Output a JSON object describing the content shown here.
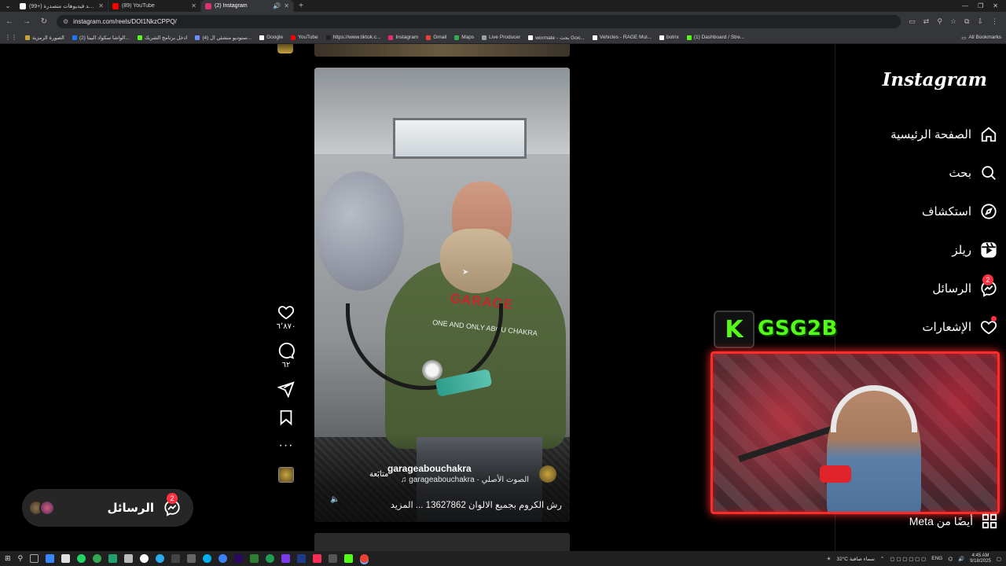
{
  "browser": {
    "tabs": [
      {
        "title": "(99+) شاهد فيديوهات متصدرة",
        "favicon_color": "#ffffff",
        "active": false
      },
      {
        "title": "(89) YouTube",
        "favicon_color": "#ff0000",
        "active": false
      },
      {
        "title": "(2) Instagram",
        "favicon_color": "#e1306c",
        "active": true
      }
    ],
    "url": "instagram.com/reels/DOI1NkzCPPQ/",
    "bookmarks": [
      {
        "label": "الصورة الرمزية",
        "color": "#c9a33b"
      },
      {
        "label": "(2) الواشا سكواد البيتا...",
        "color": "#1877f2"
      },
      {
        "label": "ادخل برنامج الشريك",
        "color": "#53fc18"
      },
      {
        "label": "(4) ستوديو منشئي ال...",
        "color": "#6c8cff"
      },
      {
        "label": "Google",
        "color": "#ffffff"
      },
      {
        "label": "YouTube",
        "color": "#ff0000"
      },
      {
        "label": "https://www.tiktok.c...",
        "color": "#222222"
      },
      {
        "label": "Instagram",
        "color": "#e1306c"
      },
      {
        "label": "Gmail",
        "color": "#ea4335"
      },
      {
        "label": "Maps",
        "color": "#34a853"
      },
      {
        "label": "Live Producer",
        "color": "#9aa0a6"
      },
      {
        "label": "wormate - بحث Goo...",
        "color": "#ffffff"
      },
      {
        "label": "Vehicles - RAGE Mul...",
        "color": "#ffffff"
      },
      {
        "label": "botrix",
        "color": "#ffffff"
      },
      {
        "label": "(1) Dashboard / Stre...",
        "color": "#53fc18"
      }
    ],
    "all_bookmarks": "All Bookmarks"
  },
  "instagram": {
    "logo": "Instagram",
    "nav": [
      {
        "label": "الصفحة الرئيسية",
        "icon": "home-icon"
      },
      {
        "label": "بحث",
        "icon": "search-icon"
      },
      {
        "label": "استكشاف",
        "icon": "explore-icon"
      },
      {
        "label": "ريلز",
        "icon": "reels-icon"
      },
      {
        "label": "الرسائل",
        "icon": "messenger-icon",
        "badge": "2"
      },
      {
        "label": "الإشعارات",
        "icon": "heart-icon",
        "dot": true
      }
    ],
    "also_from_meta": "أيضًا من Meta",
    "reel": {
      "username": "garageabouchakra",
      "follow": "متابَعة",
      "audio": "garageabouchakra · الصوت الأصلي",
      "caption": "رش الكروم بجميع الالوان 13627862 ... المزيد",
      "shirt_text": "GARAGE",
      "shirt_sub": "ONE AND ONLY ABOU CHAKRA",
      "likes": "٦٬٨٧٠",
      "comments": "٦٢"
    },
    "messages_pill": {
      "label": "الرسائل",
      "badge": "2"
    }
  },
  "stream_overlay": {
    "letter": "K",
    "channel": "GSG2B"
  },
  "taskbar": {
    "weather": "32°C سماء صافية",
    "lang": "ENG",
    "time": "4:45 AM",
    "date": "9/18/2025"
  }
}
